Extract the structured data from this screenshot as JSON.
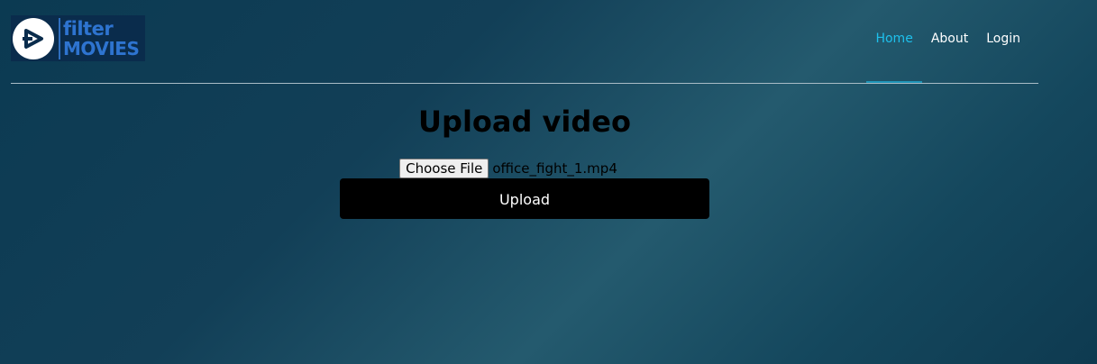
{
  "brand": {
    "line1": "filter",
    "line2": "MOVIES",
    "icon": "play-arrow-icon"
  },
  "nav": {
    "items": [
      {
        "label": "Home",
        "active": true
      },
      {
        "label": "About",
        "active": false
      },
      {
        "label": "Login",
        "active": false
      }
    ]
  },
  "main": {
    "title": "Upload video",
    "choose_label": "Choose File",
    "file_name": "office_fight_1.mp4",
    "upload_label": "Upload"
  },
  "colors": {
    "accent": "#1ec0ec",
    "brand_blue": "#2e74d0",
    "button_bg": "#000000"
  }
}
